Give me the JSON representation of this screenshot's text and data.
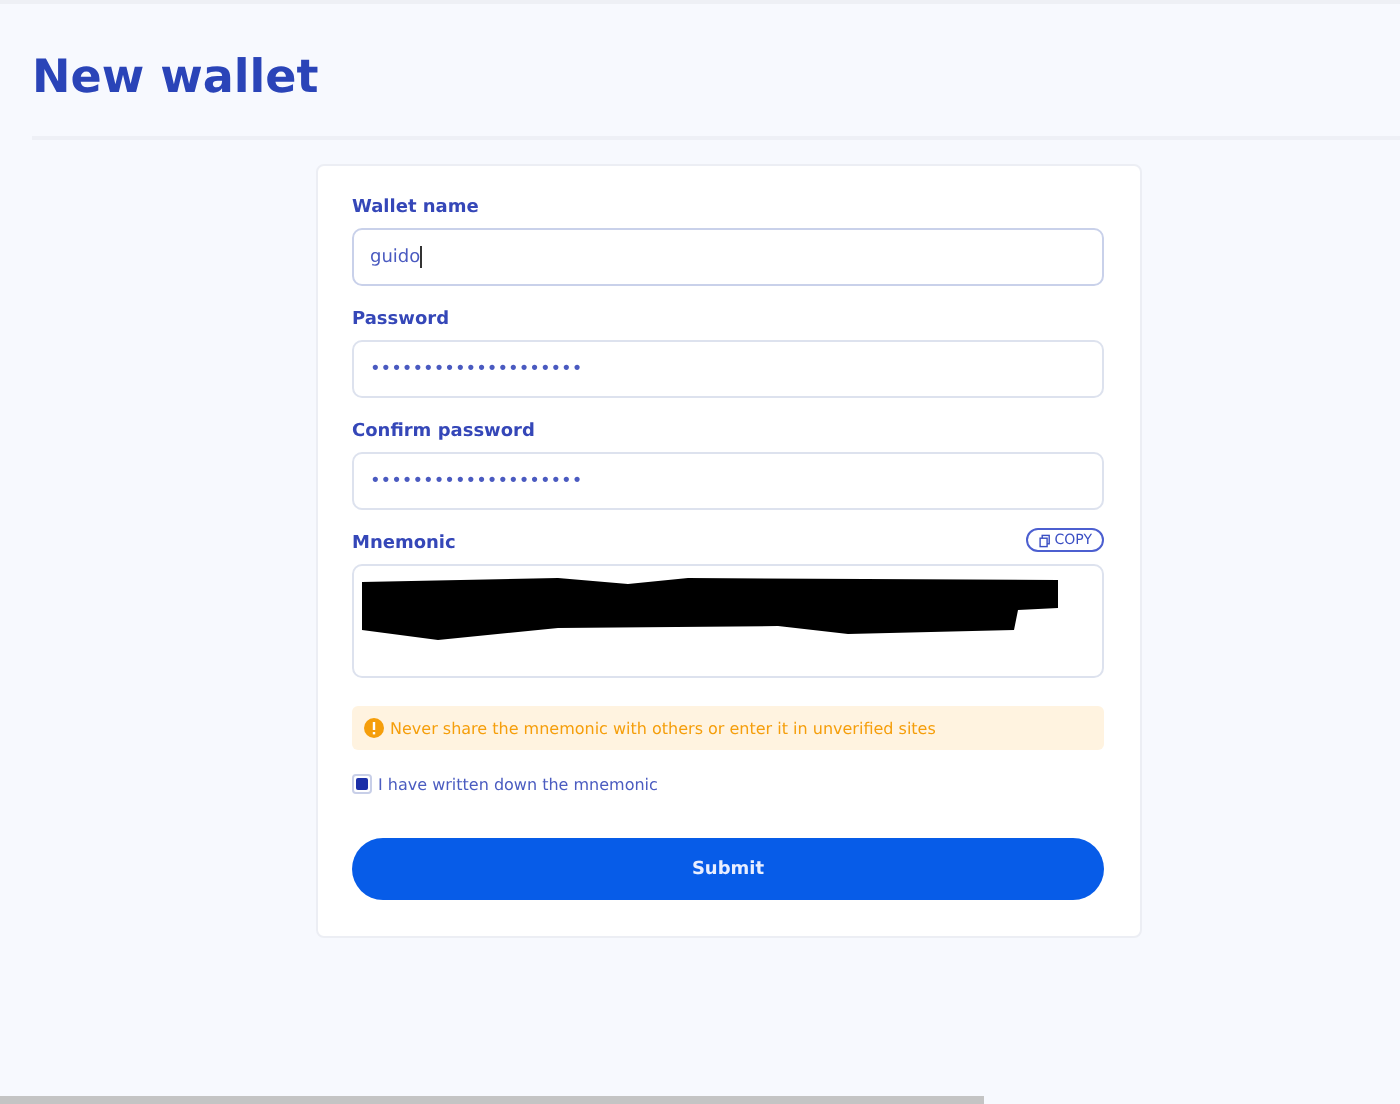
{
  "page": {
    "title": "New wallet"
  },
  "form": {
    "fields": [
      {
        "label": "Wallet name",
        "value": "guido",
        "focused": true
      },
      {
        "label": "Password",
        "value": "••••••••••••••••••••",
        "focused": false
      },
      {
        "label": "Confirm password",
        "value": "••••••••••••••••••••",
        "focused": false
      }
    ],
    "mnemonic": {
      "label": "Mnemonic",
      "copy_button": "COPY",
      "redacted": true
    },
    "warning": "Never share the mnemonic with others or enter it in unverified sites",
    "confirm": {
      "label": "I have written down the mnemonic",
      "checked": true
    },
    "submit": "Submit"
  }
}
